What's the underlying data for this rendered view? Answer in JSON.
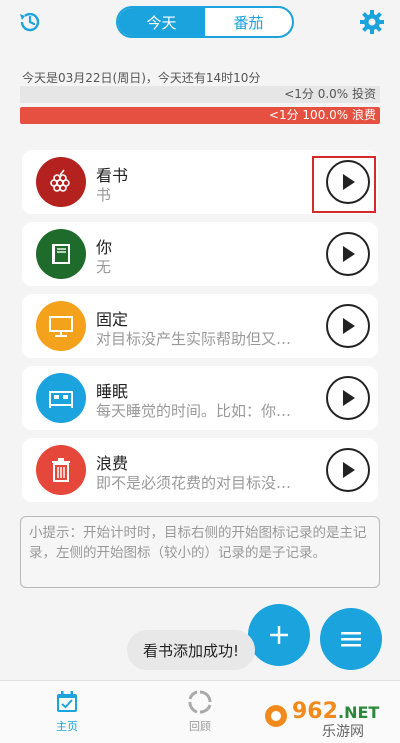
{
  "top": {
    "tabs": [
      "今天",
      "番茄"
    ]
  },
  "info": {
    "date_text": "今天是03月22日(周日)，今天还有14时10分",
    "invest_text": "<1分 0.0% 投资",
    "waste_text": "<1分 100.0% 浪费",
    "waste_fraction": 1.0,
    "invest_fraction": 0.0
  },
  "cards": [
    {
      "title": "看书",
      "subtitle": "书",
      "color": "#b3221f",
      "icon": "grapes-icon"
    },
    {
      "title": "你",
      "subtitle": "无",
      "color": "#1e6b2b",
      "icon": "book-icon"
    },
    {
      "title": "固定",
      "subtitle": "对目标没产生实际帮助但又…",
      "color": "#f4a21c",
      "icon": "monitor-icon"
    },
    {
      "title": "睡眠",
      "subtitle": "每天睡觉的时间。比如：你…",
      "color": "#1aa3dc",
      "icon": "bed-icon"
    },
    {
      "title": "浪费",
      "subtitle": "即不是必须花费的对目标没…",
      "color": "#e5473a",
      "icon": "trash-icon"
    }
  ],
  "tip": {
    "text": "小提示：开始计时时，目标右侧的开始图标记录的是主记录，左侧的开始图标（较小的）记录的是子记录。"
  },
  "toast": {
    "text": "看书添加成功!"
  },
  "bottom_nav": {
    "home_label": "主页",
    "review_label": "回顾"
  },
  "watermark": {
    "brand": "962.NET",
    "sub": "乐游网"
  },
  "colors": {
    "accent": "#1aa3dc",
    "waste": "#e55040",
    "highlight": "#d42a2a"
  }
}
